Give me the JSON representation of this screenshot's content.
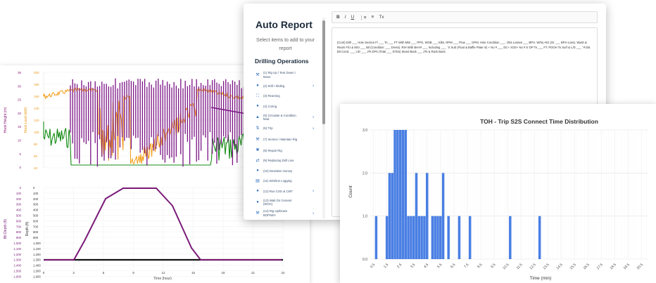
{
  "drilling_charts": {
    "top": {
      "ylabel_left": "Hook Height (m)",
      "ylabel_right": "Hook Load (klbf)",
      "left_ticks": [
        "35",
        "30",
        "25",
        "20",
        "15",
        "10",
        "5",
        "0"
      ],
      "right_ticks": [
        "200",
        "180",
        "160",
        "140",
        "120",
        "100",
        "80",
        "60",
        "40"
      ]
    },
    "bottom": {
      "ylabel_left": "Bit Depth (ft)",
      "ylabel_inner": "Depth (ft)",
      "left_ticks": [
        "0",
        "100",
        "200",
        "300",
        "400",
        "500",
        "600",
        "700",
        "800",
        "900",
        "1,000",
        "1,100",
        "1,200",
        "1,300",
        "1,400",
        "1,500",
        "1,600"
      ],
      "inner_ticks": [
        "0",
        "100",
        "200",
        "300",
        "400",
        "500",
        "600",
        "700",
        "800",
        "900",
        "1,000",
        "1,100",
        "1,200",
        "1,300",
        "1,400",
        "1,500",
        "1,600"
      ],
      "xlabel": "Time (hour)",
      "x_ticks": [
        "0",
        "3",
        "6",
        "9",
        "12",
        "15",
        "18",
        "21",
        "24"
      ]
    }
  },
  "report": {
    "title": "Auto Report",
    "subtitle": "Select items to add to your report",
    "section": "Drilling Operations",
    "operations": [
      {
        "label": "(1) Rig Up / Tear Down / Move",
        "icon": "wrench-icon",
        "chevron": ""
      },
      {
        "label": "(2) Drill / Sliding",
        "icon": "circle-icon",
        "chevron": "›"
      },
      {
        "label": "(3) Reaming",
        "icon": "expand-icon",
        "chevron": ""
      },
      {
        "label": "(4) Coring",
        "icon": "circle-icon",
        "chevron": ""
      },
      {
        "label": "(5) Circulate & Condition Mud",
        "icon": "drop-icon",
        "chevron": "›"
      },
      {
        "label": "(6) Trip",
        "icon": "arrows-icon",
        "chevron": "›"
      },
      {
        "label": "(7) Service / Maintain Rig",
        "icon": "wrench-icon",
        "chevron": ""
      },
      {
        "label": "(8) Repair Rig",
        "icon": "tools-icon",
        "chevron": ""
      },
      {
        "label": "(9) Replacing Drill Line",
        "icon": "swap-icon",
        "chevron": ""
      },
      {
        "label": "(10) Deviation Survey",
        "icon": "circle-icon",
        "chevron": ""
      },
      {
        "label": "(11) Wireline Logging",
        "icon": "chart-icon",
        "chevron": ""
      },
      {
        "label": "(12) Run CSG & CMT",
        "icon": "circle-icon",
        "chevron": "›"
      },
      {
        "label": "(13) Wait On Cement (WOC)",
        "icon": "circle-icon",
        "chevron": ""
      },
      {
        "label": "(14) Rig Up/Down BOP/WH",
        "icon": "wrench-icon",
        "chevron": "›"
      },
      {
        "label": "(15)Test BOP",
        "icon": "circle-icon",
        "chevron": ""
      }
    ],
    "toolbar": [
      "B",
      "I",
      "U",
      "⋮≡",
      "≡",
      "Tx"
    ],
    "editor_text": "(Cont) Drill ___ Hole Section F/ ___ To ___ FT With MW ___ PPG, WOB ___ Klbs, RPM ___ Flow ___ GPM. Hole Condition ___. Obs Losses ___ BPH. W/NL-NG (Or ___ BPH Loss). Wash & Ream F/U & M/U ___ Bit (Condition: ___ Dress). RIH With BHA# ___ Including ___ ' S Sub (Float & Baffle Plate In) + No # ___ DC+ XOS+ No # 5' DP To ___ FT. POOH To Surf & L/D ___ ' R.Bit. Bit Cond. ___ L/D ___ JTs DPs (Total ___ STDs) Stand Back ___ JTs & Rack Back."
  },
  "chart_data": {
    "type": "bar",
    "title": "TOH - Trip S2S Connect Time Distribution",
    "xlabel": "Time (min)",
    "ylabel": "Count",
    "xlim": [
      0.25,
      21.0
    ],
    "ylim": [
      0,
      3.0
    ],
    "y_ticks": [
      "0.0",
      "1.0",
      "2.0",
      "3.0"
    ],
    "x_ticks": [
      "0.5",
      "1.5",
      "2.5",
      "3.5",
      "4.5",
      "5.5",
      "6.5",
      "7.5",
      "8.5",
      "9.5",
      "10.5",
      "11.5",
      "12.5",
      "13.5",
      "14.5",
      "15.5",
      "16.5",
      "17.5",
      "18.5",
      "19.5",
      "20.5"
    ],
    "x_tick_values": [
      0.5,
      1.5,
      2.5,
      3.5,
      4.5,
      5.5,
      6.5,
      7.5,
      8.5,
      9.5,
      10.5,
      11.5,
      12.5,
      13.5,
      14.5,
      15.5,
      16.5,
      17.5,
      18.5,
      19.5,
      20.5
    ],
    "bin_width": 0.2,
    "bins": [
      {
        "x": 0.6,
        "count": 1
      },
      {
        "x": 1.4,
        "count": 1
      },
      {
        "x": 1.6,
        "count": 2
      },
      {
        "x": 1.8,
        "count": 2
      },
      {
        "x": 2.0,
        "count": 3
      },
      {
        "x": 2.2,
        "count": 3
      },
      {
        "x": 2.4,
        "count": 3
      },
      {
        "x": 2.6,
        "count": 3
      },
      {
        "x": 2.8,
        "count": 3
      },
      {
        "x": 3.0,
        "count": 1
      },
      {
        "x": 3.2,
        "count": 1
      },
      {
        "x": 3.4,
        "count": 1
      },
      {
        "x": 3.6,
        "count": 2
      },
      {
        "x": 3.8,
        "count": 1
      },
      {
        "x": 4.0,
        "count": 1
      },
      {
        "x": 4.2,
        "count": 1
      },
      {
        "x": 4.4,
        "count": 2
      },
      {
        "x": 4.8,
        "count": 1
      },
      {
        "x": 5.0,
        "count": 1
      },
      {
        "x": 5.2,
        "count": 1
      },
      {
        "x": 5.4,
        "count": 1
      },
      {
        "x": 5.6,
        "count": 2
      },
      {
        "x": 6.0,
        "count": 1
      },
      {
        "x": 6.8,
        "count": 1
      },
      {
        "x": 7.6,
        "count": 1
      },
      {
        "x": 10.6,
        "count": 1
      },
      {
        "x": 12.8,
        "count": 1
      }
    ],
    "bar_color": "#4a7fe3"
  }
}
